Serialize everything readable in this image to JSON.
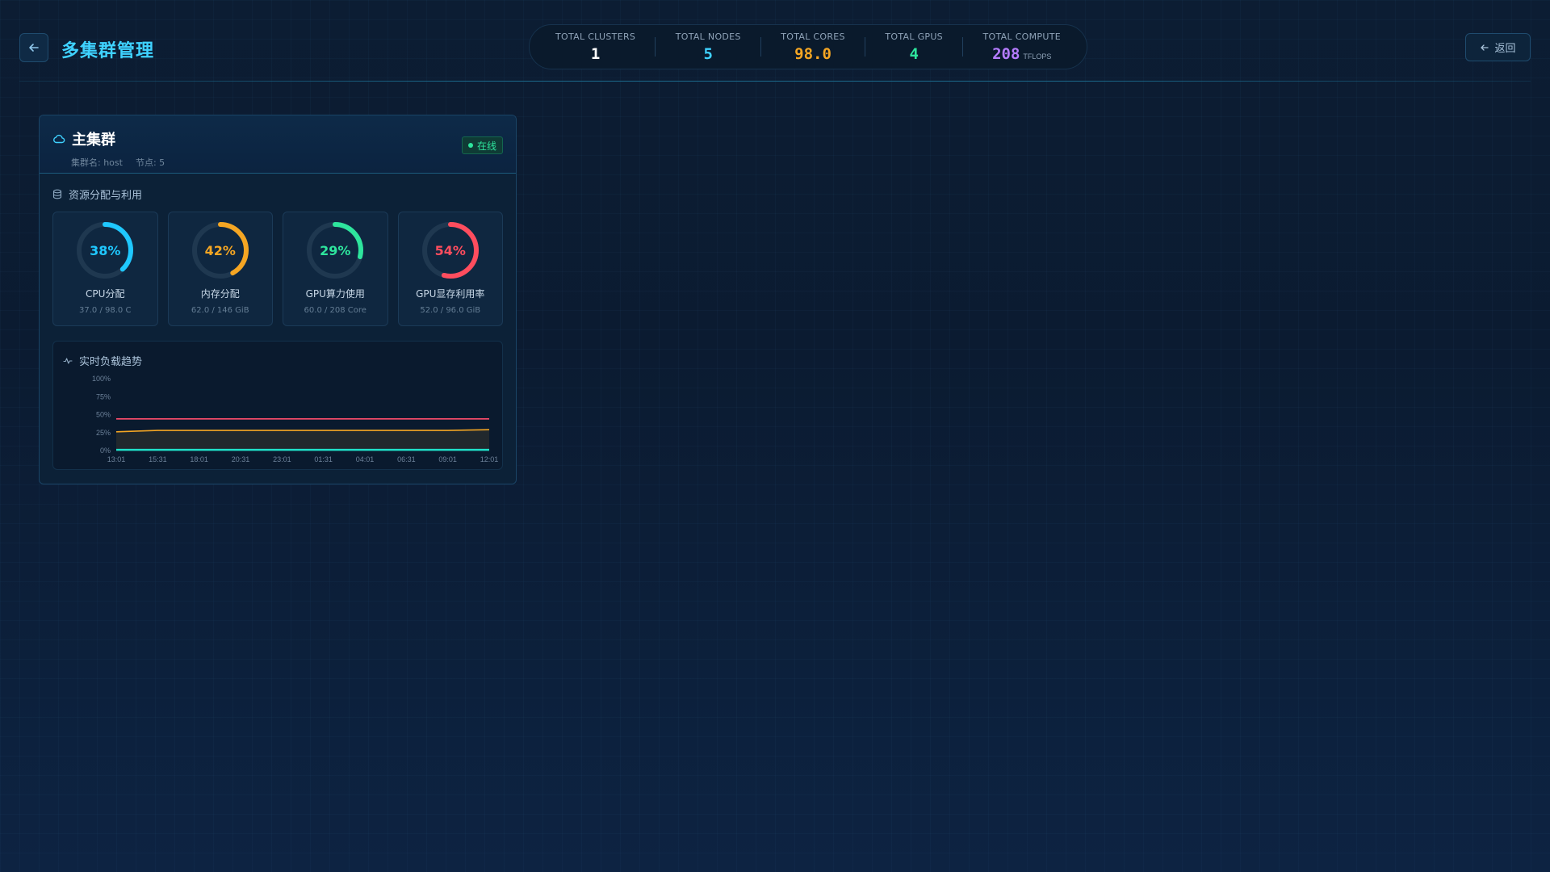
{
  "header": {
    "title": "多集群管理",
    "return_label": "返回"
  },
  "stats": [
    {
      "label": "TOTAL CLUSTERS",
      "value": "1",
      "color": "#ffffff",
      "unit": ""
    },
    {
      "label": "TOTAL NODES",
      "value": "5",
      "color": "#3fd2ff",
      "unit": ""
    },
    {
      "label": "TOTAL CORES",
      "value": "98.0",
      "color": "#f5a623",
      "unit": ""
    },
    {
      "label": "TOTAL GPUS",
      "value": "4",
      "color": "#2ee59d",
      "unit": ""
    },
    {
      "label": "TOTAL COMPUTE",
      "value": "208",
      "color": "#b57cff",
      "unit": "TFLOPS"
    }
  ],
  "cluster": {
    "name": "主集群",
    "meta_name": "集群名: host",
    "meta_nodes": "节点: 5",
    "status": "在线",
    "resources_title": "资源分配与利用",
    "gauges": [
      {
        "percent": 38,
        "percent_label": "38%",
        "label": "CPU分配",
        "detail": "37.0 / 98.0 C",
        "color": "#1fc8ff"
      },
      {
        "percent": 42,
        "percent_label": "42%",
        "label": "内存分配",
        "detail": "62.0 / 146 GiB",
        "color": "#f5a623"
      },
      {
        "percent": 29,
        "percent_label": "29%",
        "label": "GPU算力使用",
        "detail": "60.0 / 208 Core",
        "color": "#2ee59d"
      },
      {
        "percent": 54,
        "percent_label": "54%",
        "label": "GPU显存利用率",
        "detail": "52.0 / 96.0 GiB",
        "color": "#ff4d5e"
      }
    ],
    "trend_title": "实时负载趋势"
  },
  "chart_data": {
    "type": "line",
    "title": "实时负载趋势",
    "x": [
      "13:01",
      "15:31",
      "18:01",
      "20:31",
      "23:01",
      "01:31",
      "04:01",
      "06:31",
      "09:01",
      "12:01"
    ],
    "y_ticks": [
      "100%",
      "75%",
      "50%",
      "25%",
      "0%"
    ],
    "ylim": [
      0,
      100
    ],
    "series": [
      {
        "color": "#ff4d6d",
        "values": [
          44,
          44,
          44,
          44,
          44,
          44,
          44,
          44,
          44,
          44
        ]
      },
      {
        "color": "#f5a623",
        "values": [
          26,
          28,
          28,
          28,
          28,
          28,
          28,
          28,
          28,
          29
        ]
      },
      {
        "color": "#1fe0c8",
        "values": [
          1,
          1,
          1,
          1,
          1,
          1,
          1,
          1,
          1,
          1
        ]
      }
    ]
  }
}
